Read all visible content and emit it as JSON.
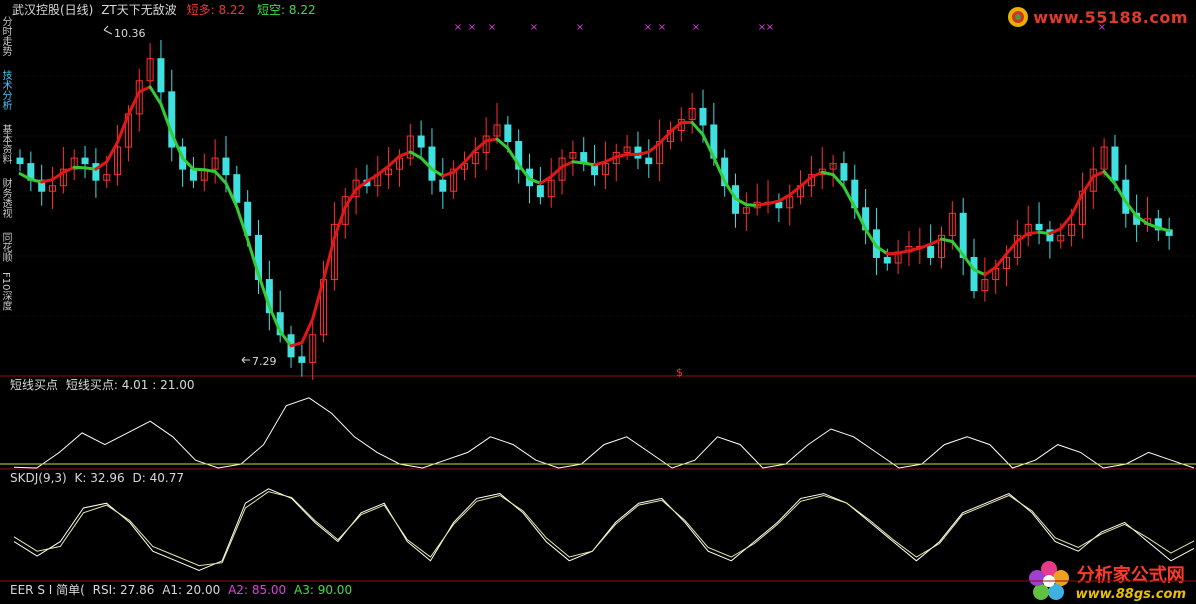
{
  "header": {
    "stock": "武汉控股(日线)",
    "indicator": "ZT天下无敌波",
    "long_label": "短多:",
    "long_value": "8.22",
    "short_label": "短空:",
    "short_value": "8.22"
  },
  "side_tabs": [
    "分时走势",
    "技术分析",
    "基本资料",
    "财务透视",
    "同花顺",
    "F10深度"
  ],
  "main_panel": {
    "high_label": "10.36",
    "low_label": "7.29",
    "dollar_mark": "$",
    "x_marks": [
      "×",
      "×",
      "×",
      "×",
      "×",
      "×",
      "×",
      "×",
      "×",
      "×",
      "×"
    ]
  },
  "panel2": {
    "title": "短线买点",
    "label": "短线买点:",
    "value1": "4.01",
    "sep": ":",
    "value2": "21.00"
  },
  "panel3": {
    "title": "SKDJ(9,3)",
    "k_label": "K:",
    "k_value": "32.96",
    "d_label": "D:",
    "d_value": "40.77"
  },
  "panel4": {
    "title": "EER S I 简单(",
    "rsi_label": "RSI:",
    "rsi_value": "27.86",
    "a1_label": "A1:",
    "a1_value": "20.00",
    "a2_label": "A2:",
    "a2_value": "85.00",
    "a3_label": "A3:",
    "a3_value": "90.00"
  },
  "watermark_top": "www.55188.com",
  "watermark_bottom": {
    "name": "分析家公式网",
    "url": "www.88gs.com"
  },
  "colors": {
    "up": "#ff3030",
    "down": "#40e0e0",
    "wave_up": "#e01818",
    "wave_down": "#33cc33",
    "k_line": "#ffffff",
    "d_line": "#e8e8a0",
    "buy_line": "#ffffff",
    "divider": "#8c1010",
    "magenta": "#e040e0",
    "green_text": "#40e040"
  },
  "chart_data": [
    {
      "type": "candlestick",
      "title": "ZT天下无敌波",
      "high_marker": 10.36,
      "low_marker": 7.29,
      "close": [
        9.15,
        9.0,
        8.9,
        8.95,
        9.1,
        9.2,
        9.15,
        9.0,
        9.05,
        9.3,
        9.6,
        9.9,
        10.1,
        9.8,
        9.3,
        9.1,
        9.0,
        9.1,
        9.2,
        9.05,
        8.8,
        8.5,
        8.1,
        7.8,
        7.6,
        7.4,
        7.35,
        7.6,
        8.1,
        8.6,
        8.85,
        9.0,
        8.95,
        9.05,
        9.1,
        9.2,
        9.4,
        9.3,
        9.0,
        8.9,
        9.1,
        9.15,
        9.25,
        9.4,
        9.5,
        9.35,
        9.1,
        8.95,
        8.85,
        9.0,
        9.2,
        9.25,
        9.15,
        9.05,
        9.15,
        9.25,
        9.3,
        9.2,
        9.15,
        9.35,
        9.45,
        9.55,
        9.65,
        9.5,
        9.2,
        8.95,
        8.7,
        8.75,
        8.8,
        8.8,
        8.75,
        8.85,
        8.95,
        9.05,
        9.1,
        9.15,
        9.0,
        8.75,
        8.55,
        8.3,
        8.25,
        8.35,
        8.4,
        8.4,
        8.3,
        8.5,
        8.7,
        8.3,
        8.0,
        8.1,
        8.2,
        8.3,
        8.5,
        8.6,
        8.55,
        8.45,
        8.5,
        8.6,
        8.9,
        9.1,
        9.3,
        9.0,
        8.7,
        8.6,
        8.65,
        8.55,
        8.5
      ]
    },
    {
      "type": "line",
      "title": "短线买点",
      "series": [
        {
          "name": "短线买点",
          "values": [
            1,
            0,
            20,
            45,
            30,
            45,
            60,
            40,
            10,
            0,
            5,
            30,
            80,
            90,
            70,
            40,
            20,
            5,
            0,
            10,
            20,
            40,
            30,
            10,
            0,
            5,
            30,
            40,
            20,
            0,
            10,
            40,
            30,
            0,
            5,
            30,
            50,
            40,
            20,
            0,
            5,
            30,
            40,
            30,
            0,
            10,
            30,
            20,
            0,
            5,
            20,
            10,
            0
          ]
        }
      ]
    },
    {
      "type": "line",
      "title": "SKDJ(9,3)",
      "series": [
        {
          "name": "K",
          "values": [
            40,
            25,
            40,
            75,
            80,
            60,
            30,
            20,
            10,
            20,
            80,
            95,
            85,
            60,
            40,
            70,
            80,
            40,
            20,
            60,
            85,
            90,
            70,
            40,
            20,
            30,
            60,
            80,
            85,
            60,
            30,
            20,
            40,
            60,
            85,
            90,
            80,
            60,
            40,
            20,
            40,
            70,
            80,
            90,
            70,
            40,
            30,
            50,
            60,
            40,
            20,
            32.96
          ]
        },
        {
          "name": "D",
          "values": [
            45,
            30,
            35,
            70,
            78,
            62,
            35,
            25,
            15,
            18,
            75,
            92,
            86,
            62,
            42,
            68,
            78,
            42,
            24,
            58,
            82,
            88,
            72,
            44,
            24,
            30,
            58,
            78,
            83,
            62,
            34,
            24,
            38,
            58,
            82,
            88,
            80,
            62,
            42,
            24,
            38,
            68,
            78,
            88,
            72,
            44,
            34,
            48,
            58,
            44,
            28,
            40.77
          ]
        }
      ]
    }
  ]
}
